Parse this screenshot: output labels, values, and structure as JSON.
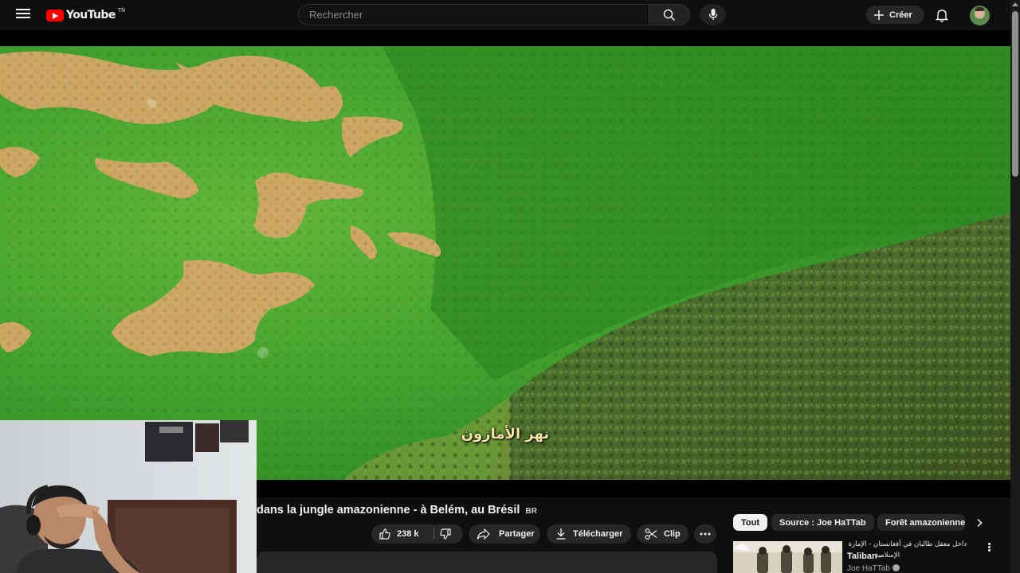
{
  "header": {
    "logo_text": "YouTube",
    "logo_suffix": "TN",
    "search_placeholder": "Rechercher",
    "create_label": "Créer"
  },
  "player": {
    "subtitle": "نهر الأمازون"
  },
  "video": {
    "title": "dans la jungle amazonienne - à Belém, au Brésil",
    "title_badge": "BR",
    "actions": {
      "like_count": "238 k",
      "share_label": "Partager",
      "download_label": "Télécharger",
      "clip_label": "Clip"
    }
  },
  "sidebar": {
    "chips": [
      "Tout",
      "Source : Joe HaTTab",
      "Forêt amazonienne"
    ],
    "suggestion": {
      "title_line1_ar": "داخل معقل طالبان في أفغانستان - الإمارة",
      "title_bold": "Taliban -",
      "title_line2_ar": "الإسلامية",
      "channel": "Joe HaTTab"
    }
  },
  "colors": {
    "background": "#0f0f0f",
    "surface": "#272727",
    "brand_red": "#ff0000",
    "text_primary": "#f1f1f1",
    "text_secondary": "#aaaaaa"
  },
  "icons": [
    "menu-icon",
    "youtube-logo-icon",
    "search-icon",
    "mic-icon",
    "plus-icon",
    "bell-icon",
    "thumbs-up-icon",
    "thumbs-down-icon",
    "share-icon",
    "download-icon",
    "scissors-icon",
    "more-horiz-icon",
    "chevron-right-icon",
    "more-vert-icon",
    "verified-icon"
  ]
}
